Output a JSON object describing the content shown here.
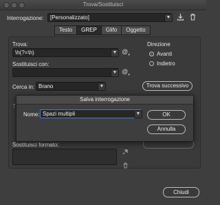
{
  "window": {
    "title": "Trova/Sostituisci"
  },
  "query": {
    "label": "Interrogazione:",
    "value": "[Personalizzato]"
  },
  "tabs": [
    {
      "label": "Testo",
      "active": false
    },
    {
      "label": "GREP",
      "active": true
    },
    {
      "label": "Glifo",
      "active": false
    },
    {
      "label": "Oggetto",
      "active": false
    }
  ],
  "find": {
    "label": "Trova:",
    "value": "\\h(?=\\h)"
  },
  "replace": {
    "label": "Sostituisci con:",
    "value": ""
  },
  "search_in": {
    "label": "Cerca in:",
    "value": "Brano"
  },
  "direction": {
    "label": "Direzione",
    "options": [
      {
        "label": "Avanti",
        "selected": true
      },
      {
        "label": "Indietro",
        "selected": false
      }
    ]
  },
  "buttons": {
    "find_next": "Trova successivo",
    "close": "Chiudi"
  },
  "replace_format": {
    "label": "Sostituisci formato:"
  },
  "dialog": {
    "title": "Salva interrogazione",
    "name_label": "Nome:",
    "name_value": "Spazi multipli",
    "ok": "OK",
    "cancel": "Annulla"
  },
  "colors": {
    "background": "#3e3e3e",
    "field": "#262626",
    "accent": "#3f7dd6"
  },
  "icons": [
    "save-query-icon",
    "delete-query-icon",
    "at-symbol-icon",
    "chevron-down-icon"
  ]
}
